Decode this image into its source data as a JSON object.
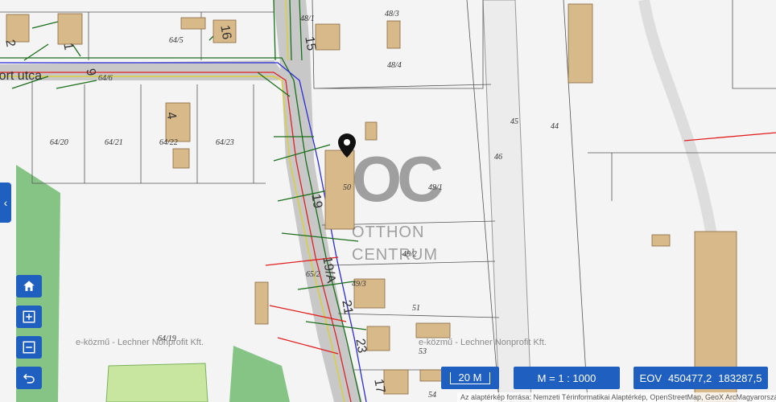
{
  "map": {
    "street_label": "Port utca",
    "parcels": [
      "64/5",
      "64/6",
      "64/20",
      "64/21",
      "64/22",
      "64/23",
      "48/1",
      "48/3",
      "48/4",
      "50",
      "49/1",
      "49/2",
      "49/3",
      "51",
      "53",
      "54",
      "45",
      "44",
      "46",
      "65/2",
      "64/19"
    ],
    "house_numbers": [
      "2",
      "1",
      "16",
      "4",
      "15",
      "19",
      "19/A",
      "21",
      "23",
      "17",
      "9"
    ],
    "watermark_provider": "e-közmű - Lechner Nonprofit Kft.",
    "watermark_logo": {
      "initials": "OC",
      "line1": "OTTHON",
      "line2": "CENTRUM"
    }
  },
  "controls": {
    "side_tab_icon": "chevron-left-icon",
    "home_icon": "home-icon",
    "zoom_in_icon": "zoom-in-icon",
    "zoom_out_icon": "zoom-out-icon",
    "back_icon": "undo-arrow-icon"
  },
  "status": {
    "scale_label": "20 M",
    "ratio_label": "M = 1 : 1000",
    "coord_label": "EOV",
    "coord_x": "450477,2",
    "coord_y": "183287,5"
  },
  "attribution": "Az alaptérkép forrása: Nemzeti Térinformatikai Alaptérkép, OpenStreetMap, GeoX ArcMagyarország",
  "colors": {
    "accent": "#1f5fbf",
    "building": "#d8b98a",
    "green": "#8bc88b"
  }
}
